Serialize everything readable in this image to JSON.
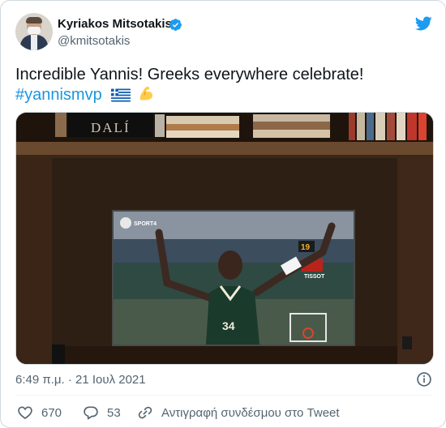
{
  "author": {
    "name": "Kyriakos Mitsotakis",
    "handle": "@kmitsotakis"
  },
  "tweet": {
    "text": "Incredible Yannis!  Greeks everywhere celebrate!",
    "hashtag": "#yannismvp"
  },
  "media": {
    "book_title": "DALÍ",
    "channel": "SPORT4",
    "scoreboard_value": "19",
    "sponsor": "TISSOT",
    "jersey_number": "34"
  },
  "meta": {
    "timestamp": "6:49 π.μ. · 21 Ιουλ 2021"
  },
  "actions": {
    "likes": "670",
    "replies": "53",
    "copy_link": "Αντιγραφή συνδέσμου στο Tweet"
  },
  "colors": {
    "accent": "#1b95e0",
    "text_secondary": "#536471",
    "verified": "#1d9bf0",
    "jersey": "#1a3a2c"
  }
}
